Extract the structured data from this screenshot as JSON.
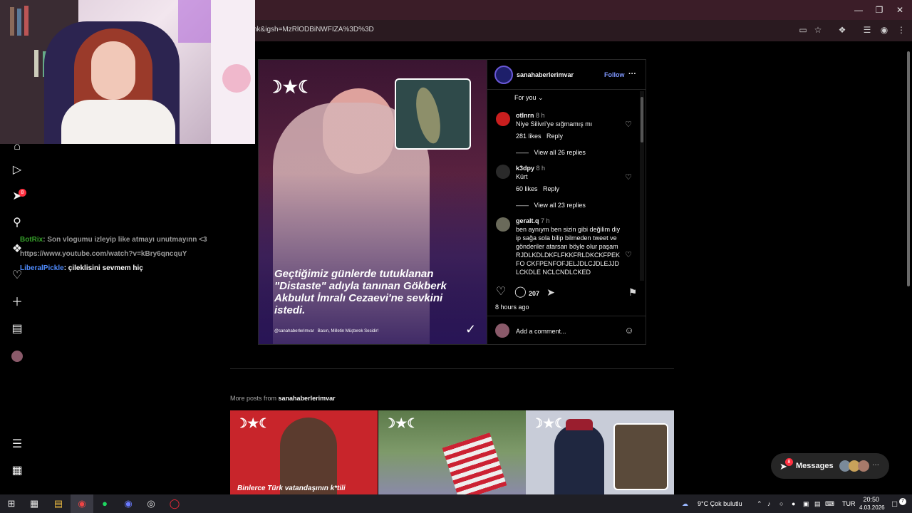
{
  "browser": {
    "url": "nk&igsh=MzRlODBiNWFIZA%3D%3D"
  },
  "chat": [
    {
      "user": "BotRix",
      "user_color": "#36a02a",
      "message": ": Son vlogumu izleyip like atmayı unutmayınn <3",
      "message_color": "#d0d0d0"
    },
    {
      "user": "",
      "user_color": "#d0d0d0",
      "message": "https://www.youtube.com/watch?v=kBry6qncquY",
      "message_color": "#d0d0d0"
    },
    {
      "user": "LiberalPickle",
      "user_color": "#4f8cff",
      "message": ": çileklisini sevmem hiç",
      "message_color": "#ffffff"
    }
  ],
  "nav": {
    "notifications_badge": "8"
  },
  "post": {
    "caption": "Geçtiğimiz günlerde tutuklanan \"Distaste\" adıyla tanınan Gökberk Akbulut İmralı Cezaevi'ne sevkini istedi.",
    "footer_handle": "@sanahaberlerimvar",
    "footer_tagline": "Basın, Milletin Müşterek Sesidir!",
    "brand_glyph": "NESS",
    "author": "sanahaberlerimvar",
    "follow": "Follow",
    "more": "···",
    "sort_label": "For you",
    "comments": [
      {
        "user": "otlnrn",
        "time": "8 h",
        "text": "Niye Silivri'ye sığmamış mı",
        "likes": "281 likes",
        "reply": "Reply",
        "view_replies": "View all 26 replies"
      },
      {
        "user": "k3dpy",
        "time": "8 h",
        "text": "Kürt",
        "likes": "60 likes",
        "reply": "Reply",
        "view_replies": "View all 23 replies"
      },
      {
        "user": "geralt.q",
        "time": "7 h",
        "text": "ben aynıym ben sizin gibi değilim diyip sağa sola bilip bilmeden tweet ve gönderiler atarsan böyle olur paşam RJDLKDLDKFLFKKFRLDKCKFPEKFO CKFPENFOFJELJDLCJDLEJJDLCKDLE NCLCNDLCKED"
      }
    ],
    "comment_count": "207",
    "posted": "8 hours ago",
    "add_comment_placeholder": "Add a comment..."
  },
  "more_posts": {
    "label_prefix": "More posts from",
    "author": "sanahaberlerimvar",
    "first_caption": "Binlerce Türk vatandaşının k*tili"
  },
  "messages": {
    "label": "Messages",
    "badge": "8"
  },
  "taskbar": {
    "weather": "9°C  Çok bulutlu",
    "language": "TUR",
    "time": "20:50",
    "date": "4.03.2026"
  }
}
